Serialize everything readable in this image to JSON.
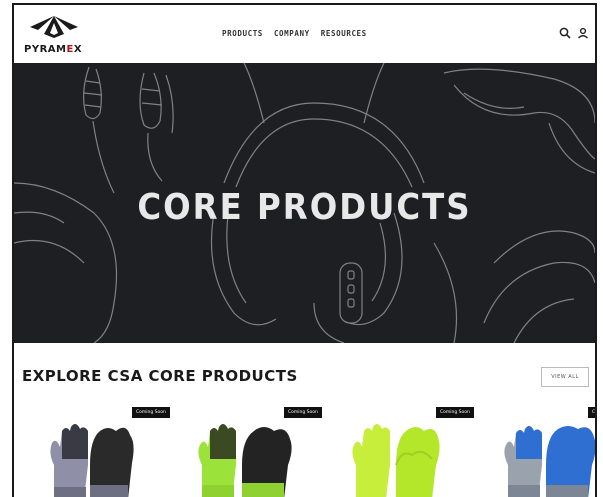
{
  "brand": {
    "name_lead": "PYRAM",
    "name_accent": "E",
    "name_tail": "X",
    "accent_color": "#b5121b"
  },
  "nav": {
    "items": [
      {
        "label": "PRODUCTS"
      },
      {
        "label": "COMPANY"
      },
      {
        "label": "RESOURCES"
      }
    ],
    "icons": [
      "search-icon",
      "user-icon"
    ]
  },
  "hero": {
    "title": "CORE PRODUCTS",
    "background": "#1d1f23"
  },
  "explore": {
    "title": "EXPLORE CSA CORE PRODUCTS",
    "view_all_label": "VIEW ALL"
  },
  "products": [
    {
      "badge": "Coming Soon",
      "palm_color": "#2a2a2a",
      "shell_color": "#8f8fa8"
    },
    {
      "badge": "Coming Soon",
      "palm_color": "#232323",
      "shell_color": "#9be33a"
    },
    {
      "badge": "Coming Soon",
      "palm_color": "#b4e62a",
      "shell_color": "#c8ee3c"
    },
    {
      "badge": "Coming Soon",
      "palm_color": "#2f6fd1",
      "shell_color": "#9aa2ad"
    }
  ]
}
